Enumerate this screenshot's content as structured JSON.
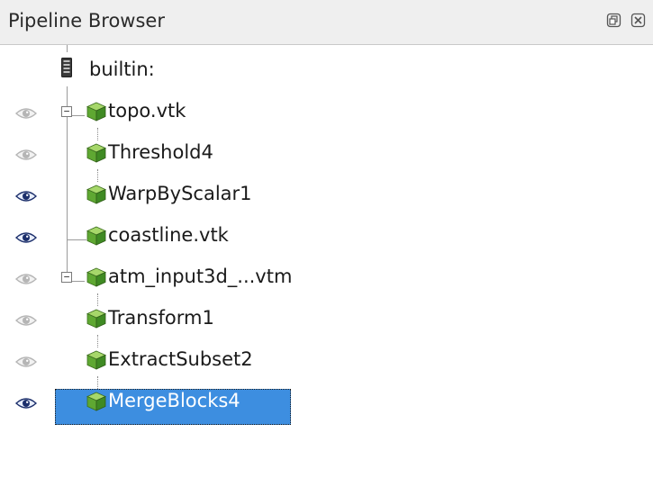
{
  "panel": {
    "title": "Pipeline Browser",
    "buttons": {
      "float_icon": "float-icon",
      "close_icon": "close-icon"
    }
  },
  "tree": {
    "root": {
      "label": "builtin:",
      "icon": "server-icon"
    },
    "items": [
      {
        "label": "topo.vtk",
        "visible": false,
        "expander": "⊟"
      },
      {
        "label": "Threshold4",
        "visible": false
      },
      {
        "label": "WarpByScalar1",
        "visible": true
      },
      {
        "label": "coastline.vtk",
        "visible": true
      },
      {
        "label": "atm_input3d_...vtm",
        "visible": false,
        "expander": "⊟"
      },
      {
        "label": "Transform1",
        "visible": false
      },
      {
        "label": "ExtractSubset2",
        "visible": false
      },
      {
        "label": "MergeBlocks4",
        "visible": true,
        "selected": true
      }
    ]
  },
  "colors": {
    "selection": "#3d8ee0",
    "eye_visible": "#1c2f6b",
    "eye_hidden": "#b5b5b5",
    "cube_green": "#5fa832"
  }
}
